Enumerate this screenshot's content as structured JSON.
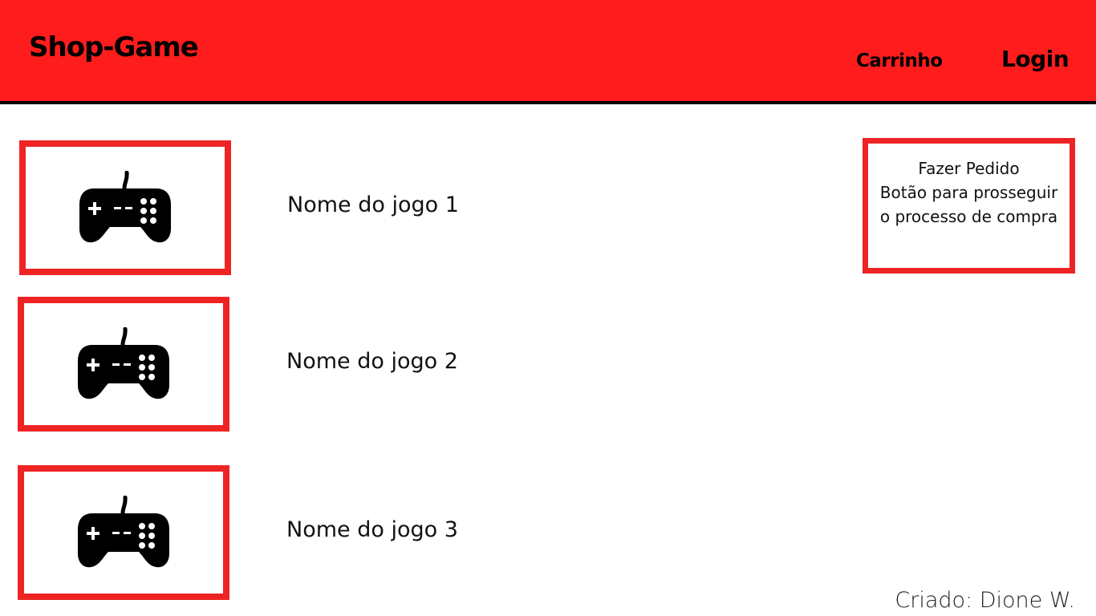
{
  "header": {
    "brand": "Shop-Game",
    "nav": {
      "cart_label": "Carrinho",
      "login_label": "Login"
    }
  },
  "games": [
    {
      "name": "Nome do jogo 1",
      "icon": "gamepad-icon"
    },
    {
      "name": "Nome do jogo 2",
      "icon": "gamepad-icon"
    },
    {
      "name": "Nome do jogo 3",
      "icon": "gamepad-icon"
    }
  ],
  "order_panel": {
    "title": "Fazer Pedido",
    "description_line1": "Botão para prosseguir",
    "description_line2": "o processo de compra"
  },
  "footer": {
    "credit": "Criado: Dione W."
  },
  "colors": {
    "header_bg": "#ff1c1c",
    "accent_border": "#ee2424",
    "text": "#000000"
  }
}
